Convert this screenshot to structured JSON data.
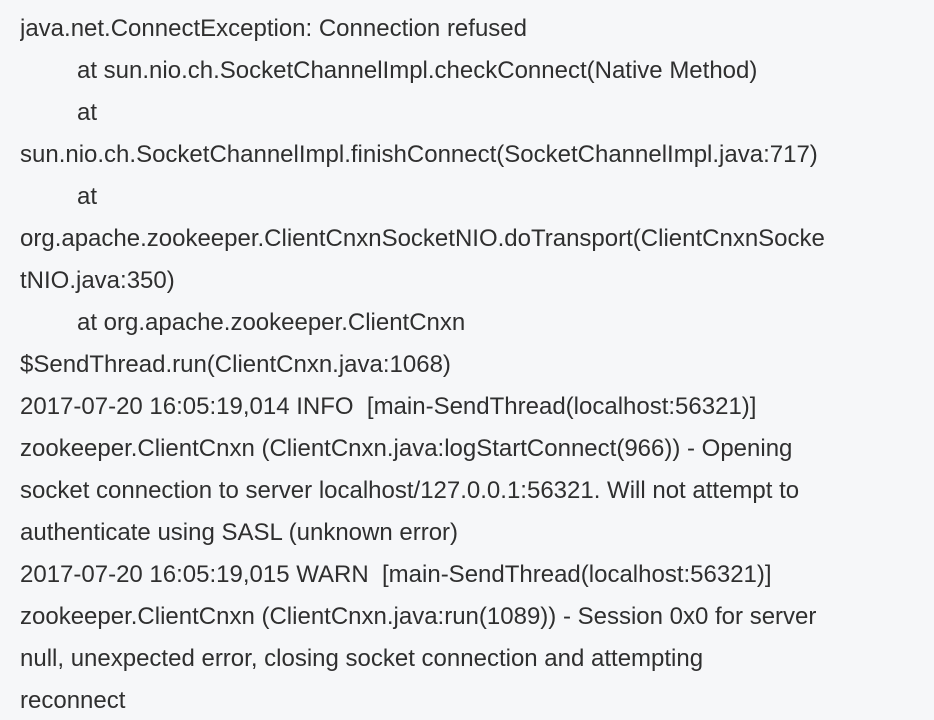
{
  "log": {
    "lines": [
      {
        "text": "java.net.ConnectException: Connection refused",
        "indent": false
      },
      {
        "text": "at sun.nio.ch.SocketChannelImpl.checkConnect(Native Method)",
        "indent": true
      },
      {
        "text": "at",
        "indent": true
      },
      {
        "text": "sun.nio.ch.SocketChannelImpl.finishConnect(SocketChannelImpl.java:717)",
        "indent": false
      },
      {
        "text": "at",
        "indent": true
      },
      {
        "text": "org.apache.zookeeper.ClientCnxnSocketNIO.doTransport(ClientCnxnSocke",
        "indent": false
      },
      {
        "text": "tNIO.java:350)",
        "indent": false
      },
      {
        "text": "at org.apache.zookeeper.ClientCnxn",
        "indent": true
      },
      {
        "text": "$SendThread.run(ClientCnxn.java:1068)",
        "indent": false
      },
      {
        "text": "2017-07-20 16:05:19,014 INFO  [main-SendThread(localhost:56321)]",
        "indent": false
      },
      {
        "text": "zookeeper.ClientCnxn (ClientCnxn.java:logStartConnect(966)) - Opening",
        "indent": false
      },
      {
        "text": "socket connection to server localhost/127.0.0.1:56321. Will not attempt to",
        "indent": false
      },
      {
        "text": "authenticate using SASL (unknown error)",
        "indent": false
      },
      {
        "text": "2017-07-20 16:05:19,015 WARN  [main-SendThread(localhost:56321)]",
        "indent": false
      },
      {
        "text": "zookeeper.ClientCnxn (ClientCnxn.java:run(1089)) - Session 0x0 for server",
        "indent": false
      },
      {
        "text": "null, unexpected error, closing socket connection and attempting",
        "indent": false
      },
      {
        "text": "reconnect",
        "indent": false
      }
    ]
  }
}
